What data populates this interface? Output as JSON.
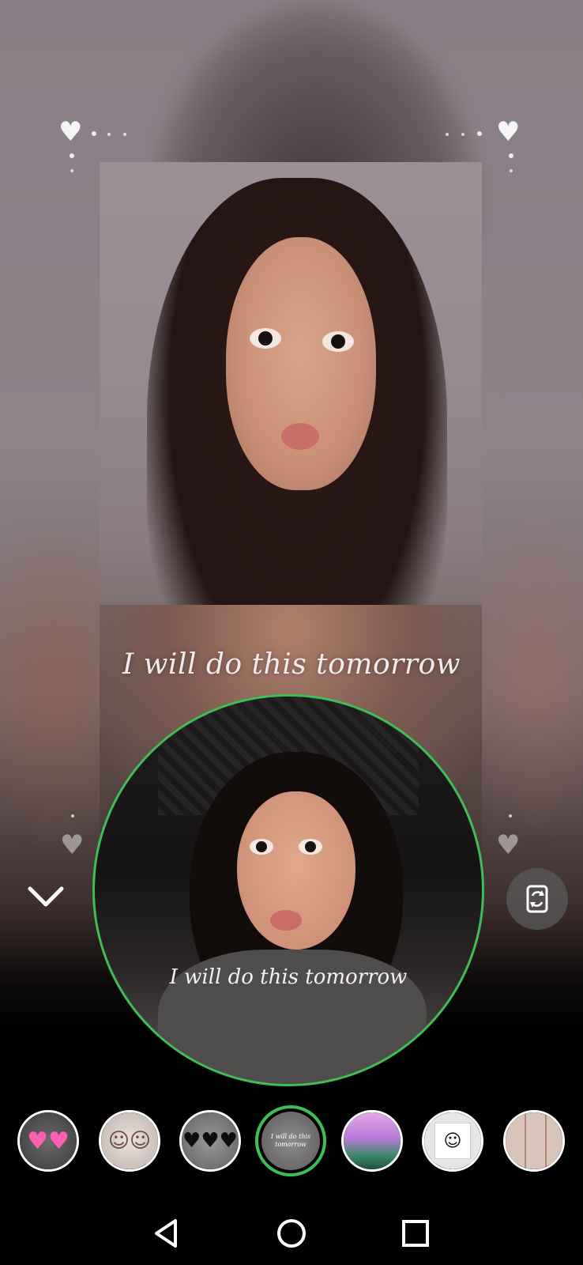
{
  "screen": {
    "caption_main": "I will do this tomorrow",
    "caption_preview": "I will do this tomorrow",
    "selected_effect_text": "I will do this tomorrow"
  },
  "controls": {
    "collapse_icon": "chevron-down-icon",
    "flip_camera_icon": "flip-camera-icon",
    "accent_color": "#3fbe55"
  },
  "effects": [
    {
      "name": "pink-hearts-effect",
      "selected": false
    },
    {
      "name": "cartoon-faces-effect",
      "selected": false
    },
    {
      "name": "black-hearts-effect",
      "selected": false
    },
    {
      "name": "text-quote-effect",
      "selected": true
    },
    {
      "name": "purple-sky-effect",
      "selected": false
    },
    {
      "name": "white-cube-face-effect",
      "selected": false
    },
    {
      "name": "photo-grid-effect",
      "selected": false
    }
  ],
  "navigation": {
    "back_icon": "back-triangle-icon",
    "home_icon": "home-circle-icon",
    "recents_icon": "recents-square-icon"
  }
}
